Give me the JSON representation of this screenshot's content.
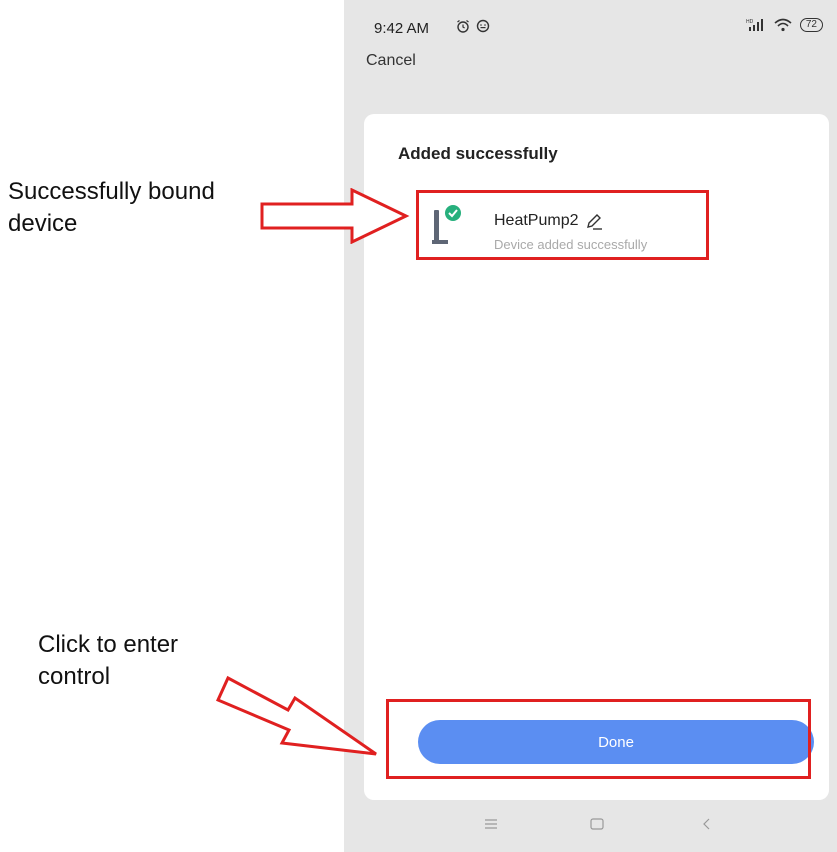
{
  "status_bar": {
    "time": "9:42 AM",
    "battery": "72",
    "network": "HD"
  },
  "header": {
    "cancel_label": "Cancel"
  },
  "card": {
    "title": "Added successfully",
    "device": {
      "name": "HeatPump2",
      "status": "Device added successfully"
    },
    "done_label": "Done"
  },
  "annotations": {
    "bound_device": [
      "Successfully bound",
      "device"
    ],
    "enter_control": [
      "Click to enter",
      "control"
    ]
  },
  "colors": {
    "accent": "#5b8ef2",
    "highlight": "#e02020",
    "check": "#27b07d"
  },
  "icons": [
    "alarm-icon",
    "face-icon",
    "signal-icon",
    "wifi-icon",
    "battery-icon",
    "heat-pump-device-icon",
    "check-badge-icon",
    "edit-pencil-icon",
    "menu-nav-icon",
    "home-nav-icon",
    "back-nav-icon",
    "arrow-right-icon"
  ]
}
